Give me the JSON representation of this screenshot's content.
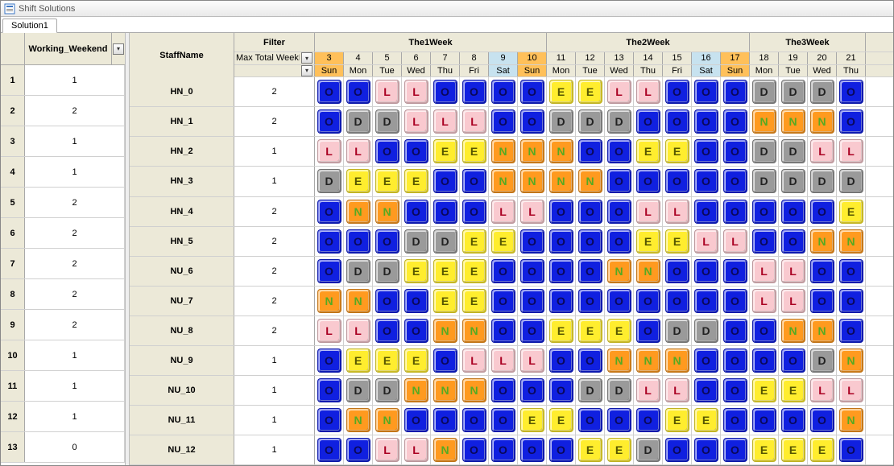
{
  "window": {
    "title": "Shift Solutions"
  },
  "tabs": [
    "Solution1"
  ],
  "left": {
    "header": "Working_Weekend",
    "rows": [
      {
        "n": "1",
        "v": "1"
      },
      {
        "n": "2",
        "v": "2"
      },
      {
        "n": "3",
        "v": "1"
      },
      {
        "n": "4",
        "v": "1"
      },
      {
        "n": "5",
        "v": "2"
      },
      {
        "n": "6",
        "v": "2"
      },
      {
        "n": "7",
        "v": "2"
      },
      {
        "n": "8",
        "v": "2"
      },
      {
        "n": "9",
        "v": "2"
      },
      {
        "n": "10",
        "v": "1"
      },
      {
        "n": "11",
        "v": "1"
      },
      {
        "n": "12",
        "v": "1"
      },
      {
        "n": "13",
        "v": "0"
      }
    ]
  },
  "headers": {
    "staff": "StaffName",
    "filter": "Filter",
    "filter_text": "Max Total WeekE",
    "weeks": [
      "The1Week",
      "The2Week",
      "The3Week"
    ],
    "days": [
      {
        "num": "3",
        "name": "Sun",
        "type": "sun",
        "w": 0
      },
      {
        "num": "4",
        "name": "Mon",
        "type": "",
        "w": 0
      },
      {
        "num": "5",
        "name": "Tue",
        "type": "",
        "w": 0
      },
      {
        "num": "6",
        "name": "Wed",
        "type": "",
        "w": 0
      },
      {
        "num": "7",
        "name": "Thu",
        "type": "",
        "w": 0
      },
      {
        "num": "8",
        "name": "Fri",
        "type": "",
        "w": 0
      },
      {
        "num": "9",
        "name": "Sat",
        "type": "sat",
        "w": 0
      },
      {
        "num": "10",
        "name": "Sun",
        "type": "sun",
        "w": 0
      },
      {
        "num": "11",
        "name": "Mon",
        "type": "",
        "w": 1
      },
      {
        "num": "12",
        "name": "Tue",
        "type": "",
        "w": 1
      },
      {
        "num": "13",
        "name": "Wed",
        "type": "",
        "w": 1
      },
      {
        "num": "14",
        "name": "Thu",
        "type": "",
        "w": 1
      },
      {
        "num": "15",
        "name": "Fri",
        "type": "",
        "w": 1
      },
      {
        "num": "16",
        "name": "Sat",
        "type": "sat",
        "w": 1
      },
      {
        "num": "17",
        "name": "Sun",
        "type": "sun",
        "w": 1
      },
      {
        "num": "18",
        "name": "Mon",
        "type": "",
        "w": 2
      },
      {
        "num": "19",
        "name": "Tue",
        "type": "",
        "w": 2
      },
      {
        "num": "20",
        "name": "Wed",
        "type": "",
        "w": 2
      },
      {
        "num": "21",
        "name": "Thu",
        "type": "",
        "w": 2
      }
    ]
  },
  "shift_colors": {
    "O": "#1020e0",
    "L": "#f9c9cf",
    "E": "#ffed2e",
    "N": "#ff9a1f",
    "D": "#9a9a9a"
  },
  "rows": [
    {
      "staff": "HN_0",
      "filter": "2",
      "shifts": [
        "O",
        "O",
        "L",
        "L",
        "O",
        "O",
        "O",
        "O",
        "E",
        "E",
        "L",
        "L",
        "O",
        "O",
        "O",
        "D",
        "D",
        "D",
        "O"
      ]
    },
    {
      "staff": "HN_1",
      "filter": "2",
      "shifts": [
        "O",
        "D",
        "D",
        "L",
        "L",
        "L",
        "O",
        "O",
        "D",
        "D",
        "D",
        "O",
        "O",
        "O",
        "O",
        "N",
        "N",
        "N",
        "O"
      ]
    },
    {
      "staff": "HN_2",
      "filter": "1",
      "shifts": [
        "L",
        "L",
        "O",
        "O",
        "E",
        "E",
        "N",
        "N",
        "N",
        "O",
        "O",
        "E",
        "E",
        "O",
        "O",
        "D",
        "D",
        "L",
        "L"
      ]
    },
    {
      "staff": "HN_3",
      "filter": "1",
      "shifts": [
        "D",
        "E",
        "E",
        "E",
        "O",
        "O",
        "N",
        "N",
        "N",
        "N",
        "O",
        "O",
        "O",
        "O",
        "O",
        "D",
        "D",
        "D",
        "D"
      ]
    },
    {
      "staff": "HN_4",
      "filter": "2",
      "shifts": [
        "O",
        "N",
        "N",
        "O",
        "O",
        "O",
        "L",
        "L",
        "O",
        "O",
        "O",
        "L",
        "L",
        "O",
        "O",
        "O",
        "O",
        "O",
        "E"
      ]
    },
    {
      "staff": "HN_5",
      "filter": "2",
      "shifts": [
        "O",
        "O",
        "O",
        "D",
        "D",
        "E",
        "E",
        "O",
        "O",
        "O",
        "O",
        "E",
        "E",
        "L",
        "L",
        "O",
        "O",
        "N",
        "N"
      ]
    },
    {
      "staff": "NU_6",
      "filter": "2",
      "shifts": [
        "O",
        "D",
        "D",
        "E",
        "E",
        "E",
        "O",
        "O",
        "O",
        "O",
        "N",
        "N",
        "O",
        "O",
        "O",
        "L",
        "L",
        "O",
        "O"
      ]
    },
    {
      "staff": "NU_7",
      "filter": "2",
      "shifts": [
        "N",
        "N",
        "O",
        "O",
        "E",
        "E",
        "O",
        "O",
        "O",
        "O",
        "O",
        "O",
        "O",
        "O",
        "O",
        "L",
        "L",
        "O",
        "O"
      ]
    },
    {
      "staff": "NU_8",
      "filter": "2",
      "shifts": [
        "L",
        "L",
        "O",
        "O",
        "N",
        "N",
        "O",
        "O",
        "E",
        "E",
        "E",
        "O",
        "D",
        "D",
        "O",
        "O",
        "N",
        "N",
        "O"
      ]
    },
    {
      "staff": "NU_9",
      "filter": "1",
      "shifts": [
        "O",
        "E",
        "E",
        "E",
        "O",
        "L",
        "L",
        "L",
        "O",
        "O",
        "N",
        "N",
        "N",
        "O",
        "O",
        "O",
        "O",
        "D",
        "N"
      ]
    },
    {
      "staff": "NU_10",
      "filter": "1",
      "shifts": [
        "O",
        "D",
        "D",
        "N",
        "N",
        "N",
        "O",
        "O",
        "O",
        "D",
        "D",
        "L",
        "L",
        "O",
        "O",
        "E",
        "E",
        "L",
        "L"
      ]
    },
    {
      "staff": "NU_11",
      "filter": "1",
      "shifts": [
        "O",
        "N",
        "N",
        "O",
        "O",
        "O",
        "O",
        "E",
        "E",
        "O",
        "O",
        "O",
        "E",
        "E",
        "O",
        "O",
        "O",
        "O",
        "N"
      ]
    },
    {
      "staff": "NU_12",
      "filter": "1",
      "shifts": [
        "O",
        "O",
        "L",
        "L",
        "N",
        "O",
        "O",
        "O",
        "O",
        "E",
        "E",
        "D",
        "O",
        "O",
        "O",
        "E",
        "E",
        "E",
        "O"
      ]
    }
  ]
}
